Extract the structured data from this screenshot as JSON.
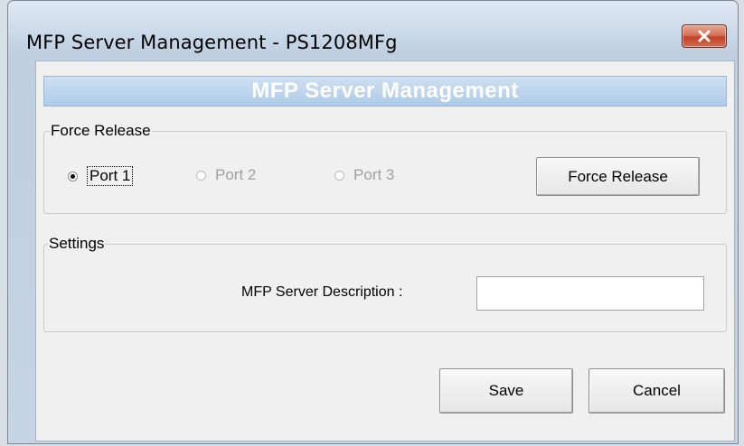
{
  "window": {
    "title": "MFP Server Management - PS1208MFg"
  },
  "banner": {
    "title": "MFP Server Management"
  },
  "force_release": {
    "legend": "Force Release",
    "ports": [
      {
        "label": "Port 1",
        "checked": true,
        "enabled": true
      },
      {
        "label": "Port 2",
        "checked": false,
        "enabled": false
      },
      {
        "label": "Port 3",
        "checked": false,
        "enabled": false
      }
    ],
    "button_label": "Force Release"
  },
  "settings": {
    "legend": "Settings",
    "description_label": "MFP Server Description :",
    "description_value": ""
  },
  "footer": {
    "save_label": "Save",
    "cancel_label": "Cancel"
  },
  "colors": {
    "banner_bg": "#aecbe8",
    "close_button": "#c2432a"
  }
}
